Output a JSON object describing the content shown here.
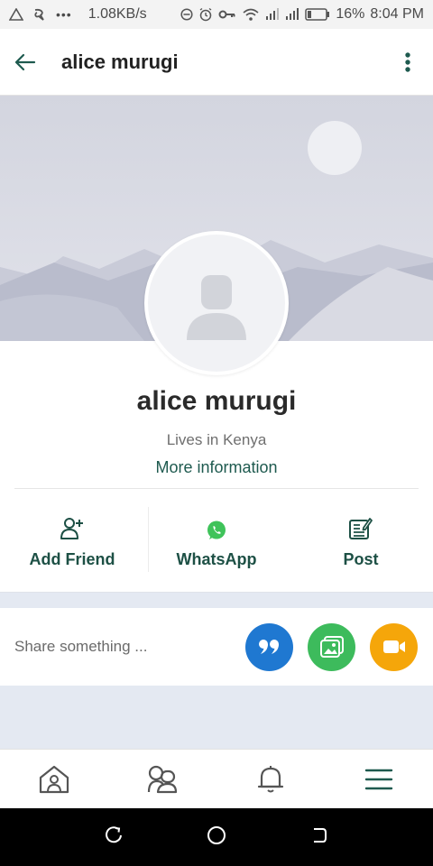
{
  "status_bar": {
    "speed": "1.08KB/s",
    "battery": "16%",
    "time": "8:04 PM",
    "dots": "•••"
  },
  "app_bar": {
    "title": "alice murugi"
  },
  "profile": {
    "name": "alice murugi",
    "location": "Lives in Kenya",
    "more_info": "More information"
  },
  "actions": [
    {
      "label": "Add Friend",
      "icon": "add-friend-icon"
    },
    {
      "label": "WhatsApp",
      "icon": "whatsapp-icon"
    },
    {
      "label": "Post",
      "icon": "post-icon"
    }
  ],
  "share": {
    "placeholder": "Share something ...",
    "buttons": [
      {
        "icon": "quote-icon",
        "color": "#1f78d1"
      },
      {
        "icon": "image-icon",
        "color": "#3dbb5c"
      },
      {
        "icon": "video-icon",
        "color": "#f5a60a"
      }
    ]
  },
  "bottom_nav": [
    {
      "icon": "home-icon"
    },
    {
      "icon": "groups-icon"
    },
    {
      "icon": "bell-icon"
    },
    {
      "icon": "menu-icon"
    }
  ],
  "colors": {
    "accent": "#1e5a4f",
    "whatsapp": "#3fc35a"
  }
}
